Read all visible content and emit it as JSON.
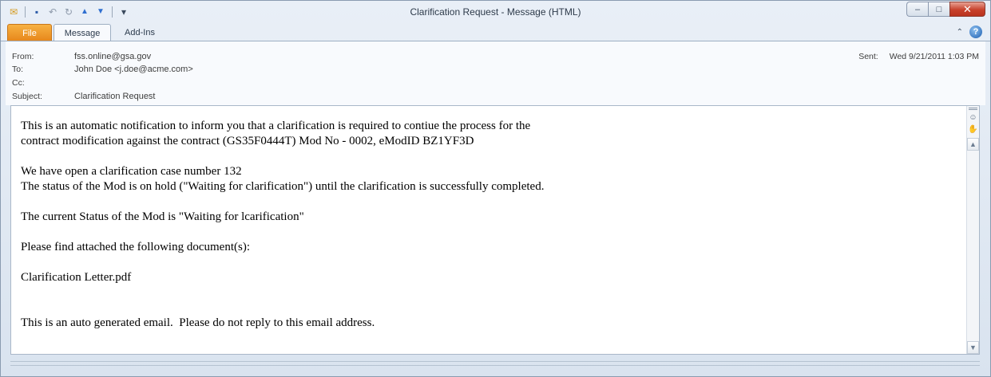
{
  "window": {
    "title": "Clarification Request  -  Message (HTML)",
    "controls": {
      "minimize": "–",
      "maximize": "□",
      "close": "✕"
    }
  },
  "quick_access": {
    "icons": [
      "envelope-icon",
      "save-icon",
      "undo-icon",
      "redo-icon",
      "previous-item-icon",
      "next-item-icon",
      "customize-icon"
    ],
    "glyphs": {
      "envelope": "✉",
      "save": "▪",
      "undo": "↶",
      "redo": "↻",
      "previous": "▲",
      "next": "▼",
      "customize": "▾"
    }
  },
  "ribbon": {
    "tabs": [
      {
        "label": "File"
      },
      {
        "label": "Message"
      },
      {
        "label": "Add-Ins"
      }
    ],
    "minimize_glyph": "⌃",
    "help_glyph": "?"
  },
  "header": {
    "from_label": "From:",
    "from_value": "fss.online@gsa.gov",
    "to_label": "To:",
    "to_value": "John Doe <j.doe@acme.com>",
    "cc_label": "Cc:",
    "cc_value": "",
    "subject_label": "Subject:",
    "subject_value": "Clarification Request",
    "sent_label": "Sent:",
    "sent_value": "Wed 9/21/2011 1:03 PM"
  },
  "message": {
    "lines": [
      "This is an automatic notification to inform you that a clarification is required to contiue the process for the",
      "contract modification against the contract (GS35F0444T) Mod No - 0002, eModID BZ1YF3D",
      "",
      "We have open a clarification case number 132",
      "The status of the Mod is on hold (\"Waiting for clarification\") until the clarification is successfully completed.",
      "",
      "The current Status of the Mod is \"Waiting for lcarification\"",
      "",
      "Please find attached the following document(s):",
      "",
      "Clarification Letter.pdf",
      "",
      "",
      "This is an auto generated email.  Please do not reply to this email address."
    ]
  },
  "scrollbar": {
    "up": "▲",
    "down": "▼",
    "people_icon": "☺",
    "hand_icon": "✋"
  },
  "colors": {
    "file_tab": "#e6861a",
    "close_button": "#c7412b",
    "help": "#1d5fb0"
  }
}
